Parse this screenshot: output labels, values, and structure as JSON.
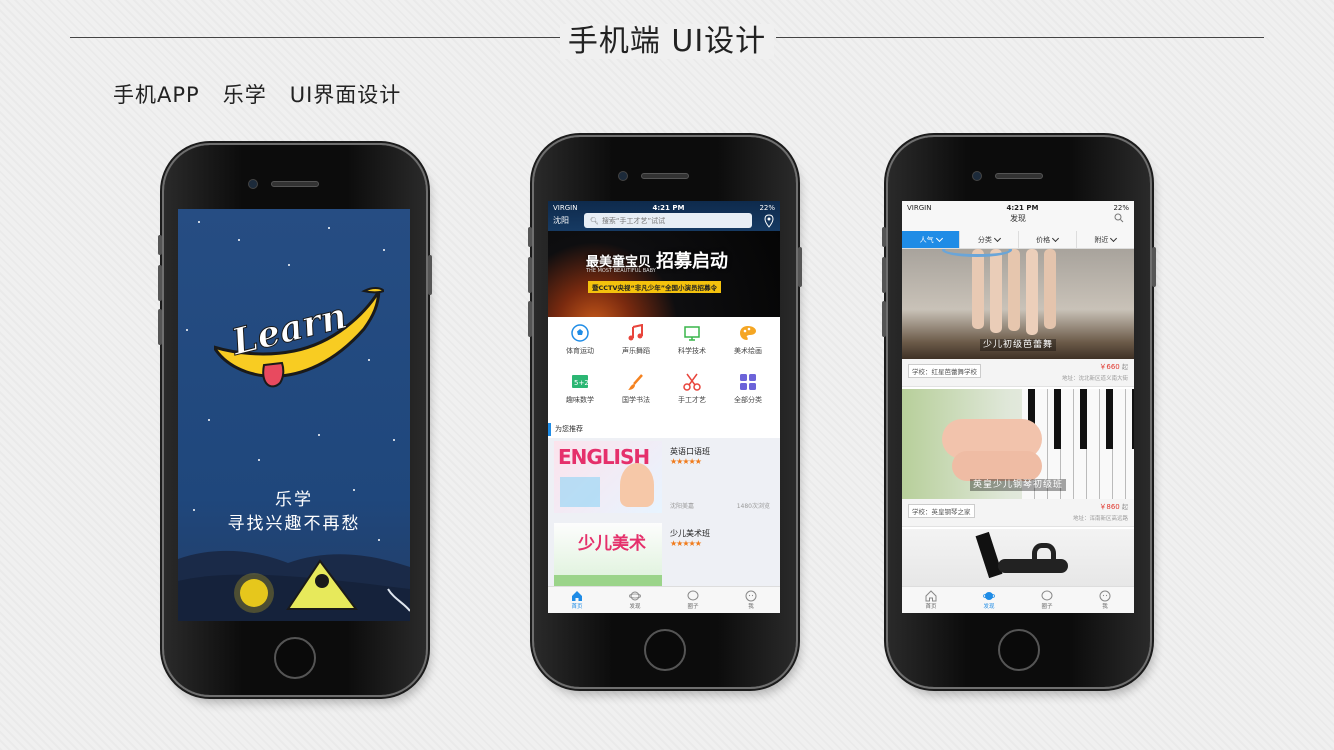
{
  "header": {
    "title": "手机端 UI设计",
    "subtitle": "手机APP   乐学   UI界面设计"
  },
  "colors": {
    "accent": "#1f8ce6",
    "splash_bg": "#264d83",
    "price": "#e0352b",
    "rating": "#f07a1a"
  },
  "splash": {
    "logo_text": "Learn",
    "app_name": "乐学",
    "slogan": "寻找兴趣不再愁"
  },
  "status_bar": {
    "carrier": "VIRGIN",
    "time": "4:21 PM",
    "battery": "22%"
  },
  "home_screen": {
    "city": "沈阳",
    "search_placeholder": "搜索“手工才艺”试试",
    "banner": {
      "headline": "最美童宝贝",
      "headline_en": "THE MOST BEAUTIFUL BABY",
      "big_text": "招募启动",
      "sub_text": "暨CCTV央视“非凡少年”全国小演员招募令"
    },
    "categories": [
      {
        "label": "体育运动",
        "icon": "soccer-icon"
      },
      {
        "label": "声乐舞蹈",
        "icon": "music-note-icon"
      },
      {
        "label": "科学技术",
        "icon": "monitor-icon"
      },
      {
        "label": "美术绘画",
        "icon": "palette-icon"
      },
      {
        "label": "趣味数学",
        "icon": "math-board-icon"
      },
      {
        "label": "国学书法",
        "icon": "brush-icon"
      },
      {
        "label": "手工才艺",
        "icon": "scissors-icon"
      },
      {
        "label": "全部分类",
        "icon": "grid-icon"
      }
    ],
    "recommend_title": "为您推荐",
    "courses": [
      {
        "name": "英语口语班",
        "rating": "★★★★★",
        "place": "沈阳美嘉",
        "visits": "1480次浏览",
        "thumb_text": "ENGLISH"
      },
      {
        "name": "少儿美术班",
        "rating": "★★★★★",
        "thumb_text": "少儿美术"
      }
    ],
    "tabs": [
      {
        "label": "首页",
        "icon": "home-icon"
      },
      {
        "label": "发现",
        "icon": "planet-icon"
      },
      {
        "label": "圈子",
        "icon": "chat-icon"
      },
      {
        "label": "我",
        "icon": "face-icon"
      }
    ]
  },
  "discover_screen": {
    "title": "发现",
    "filters": [
      "人气",
      "分类",
      "价格",
      "附近"
    ],
    "cards": [
      {
        "caption": "少儿初级芭蕾舞",
        "school": "学校：红星芭蕾舞学校",
        "price": "￥660",
        "unit": "起",
        "address": "地址：沈北新区道义南大街"
      },
      {
        "caption": "英皇少儿钢琴初级班",
        "school": "学校：英皇钢琴之家",
        "price": "￥860",
        "unit": "起",
        "address": "地址：浑南新区高远路"
      }
    ],
    "tabs": [
      {
        "label": "首页",
        "icon": "home-icon"
      },
      {
        "label": "发现",
        "icon": "planet-icon"
      },
      {
        "label": "圈子",
        "icon": "chat-icon"
      },
      {
        "label": "我",
        "icon": "face-icon"
      }
    ]
  }
}
